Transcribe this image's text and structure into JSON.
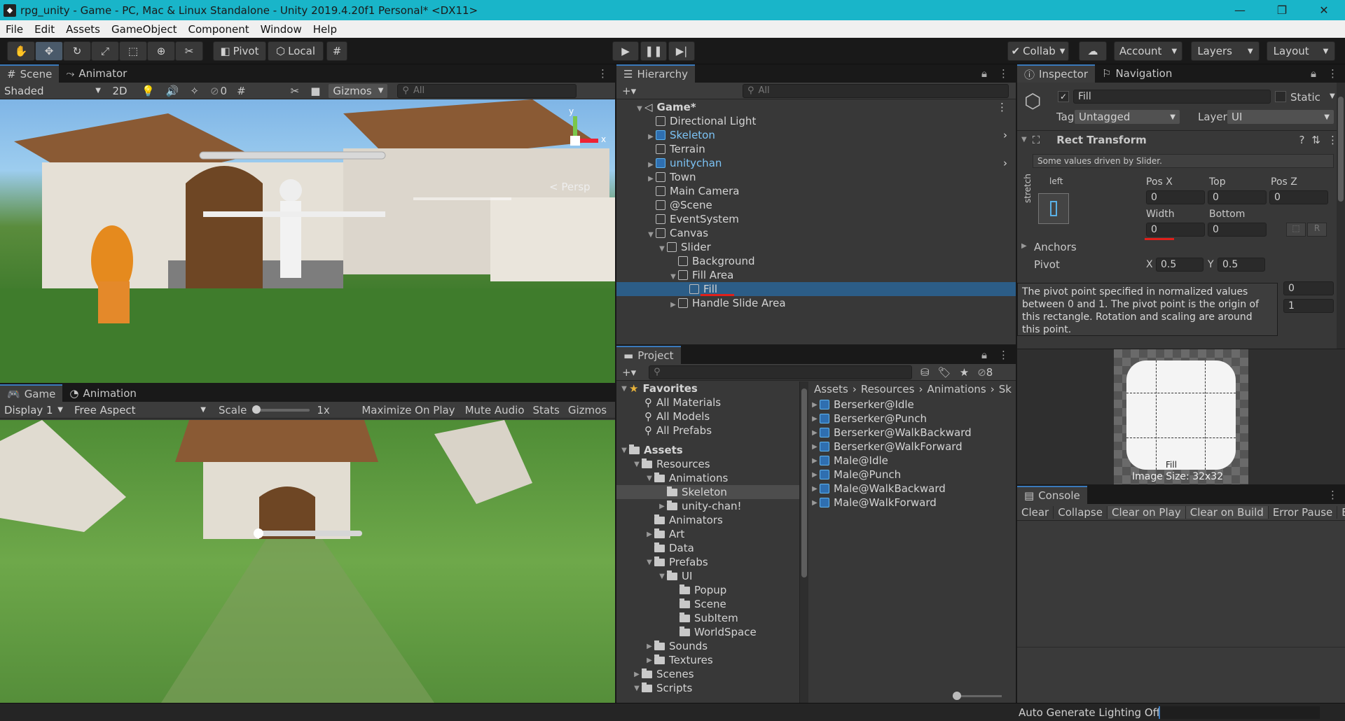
{
  "window": {
    "title": "rpg_unity - Game - PC, Mac & Linux Standalone - Unity 2019.4.20f1 Personal* <DX11>",
    "min": "—",
    "max": "❐",
    "close": "✕"
  },
  "menu": [
    "File",
    "Edit",
    "Assets",
    "GameObject",
    "Component",
    "Window",
    "Help"
  ],
  "toolbar": {
    "pivot": "Pivot",
    "local": "Local",
    "collab": "Collab",
    "account": "Account",
    "layers": "Layers",
    "layout": "Layout"
  },
  "scene": {
    "tabs": {
      "scene": "Scene",
      "animator": "Animator"
    },
    "shading": "Shaded",
    "mode2d": "2D",
    "hidden_count": "0",
    "gizmos": "Gizmos",
    "search_placeholder": "All",
    "gizmo_persp": "< Persp",
    "axis_y": "y",
    "axis_x": "x"
  },
  "game": {
    "tabs": {
      "game": "Game",
      "animation": "Animation"
    },
    "display": "Display 1",
    "aspect": "Free Aspect",
    "scale_label": "Scale",
    "scale_value": "1x",
    "maximize": "Maximize On Play",
    "mute": "Mute Audio",
    "stats": "Stats",
    "gizmos": "Gizmos"
  },
  "hierarchy": {
    "tab": "Hierarchy",
    "search_placeholder": "All",
    "rows": [
      {
        "label": "Game*",
        "indent": 0,
        "expanded": true,
        "scene": true
      },
      {
        "label": "Directional Light",
        "indent": 1
      },
      {
        "label": "Skeleton",
        "indent": 1,
        "prefab": true,
        "collapsed": true
      },
      {
        "label": "Terrain",
        "indent": 1
      },
      {
        "label": "unitychan",
        "indent": 1,
        "prefab": true,
        "collapsed": true
      },
      {
        "label": "Town",
        "indent": 1,
        "collapsed": true
      },
      {
        "label": "Main Camera",
        "indent": 1
      },
      {
        "label": "@Scene",
        "indent": 1
      },
      {
        "label": "EventSystem",
        "indent": 1
      },
      {
        "label": "Canvas",
        "indent": 1,
        "expanded": true
      },
      {
        "label": "Slider",
        "indent": 2,
        "expanded": true
      },
      {
        "label": "Background",
        "indent": 3
      },
      {
        "label": "Fill Area",
        "indent": 3,
        "expanded": true
      },
      {
        "label": "Fill",
        "indent": 4,
        "selected": true
      },
      {
        "label": "Handle Slide Area",
        "indent": 3,
        "collapsed": true
      }
    ]
  },
  "project": {
    "tab": "Project",
    "hidden_count": "8",
    "favorites": {
      "label": "Favorites",
      "items": [
        "All Materials",
        "All Models",
        "All Prefabs"
      ]
    },
    "assets_tree": [
      {
        "label": "Assets",
        "indent": 0,
        "expanded": true,
        "bold": true
      },
      {
        "label": "Resources",
        "indent": 1,
        "expanded": true
      },
      {
        "label": "Animations",
        "indent": 2,
        "expanded": true
      },
      {
        "label": "Skeleton",
        "indent": 3,
        "selected": true
      },
      {
        "label": "unity-chan!",
        "indent": 3,
        "collapsed": true
      },
      {
        "label": "Animators",
        "indent": 2
      },
      {
        "label": "Art",
        "indent": 2,
        "collapsed": true
      },
      {
        "label": "Data",
        "indent": 2
      },
      {
        "label": "Prefabs",
        "indent": 2,
        "expanded": true
      },
      {
        "label": "UI",
        "indent": 3,
        "expanded": true
      },
      {
        "label": "Popup",
        "indent": 4
      },
      {
        "label": "Scene",
        "indent": 4
      },
      {
        "label": "SubItem",
        "indent": 4
      },
      {
        "label": "WorldSpace",
        "indent": 4
      },
      {
        "label": "Sounds",
        "indent": 2,
        "collapsed": true
      },
      {
        "label": "Textures",
        "indent": 2,
        "collapsed": true
      },
      {
        "label": "Scenes",
        "indent": 1,
        "collapsed": true
      },
      {
        "label": "Scripts",
        "indent": 1,
        "expanded": true
      }
    ],
    "breadcrumb": [
      "Assets",
      "Resources",
      "Animations",
      "Sk"
    ],
    "files": [
      "Berserker@Idle",
      "Berserker@Punch",
      "Berserker@WalkBackward",
      "Berserker@WalkForward",
      "Male@Idle",
      "Male@Punch",
      "Male@WalkBackward",
      "Male@WalkForward"
    ]
  },
  "inspector": {
    "tabs": {
      "inspector": "Inspector",
      "navigation": "Navigation"
    },
    "name": "Fill",
    "static": "Static",
    "tag_label": "Tag",
    "tag": "Untagged",
    "layer_label": "Layer",
    "layer": "UI",
    "component": "Rect Transform",
    "driven_note": "Some values driven by Slider.",
    "anchor_preset_top": "left",
    "anchor_preset_side": "stretch",
    "fields": {
      "posx_label": "Pos X",
      "posx": "0",
      "top_label": "Top",
      "top": "0",
      "posz_label": "Pos Z",
      "posz": "0",
      "width_label": "Width",
      "width": "0",
      "bottom_label": "Bottom",
      "bottom": "0"
    },
    "anchors_label": "Anchors",
    "pivot_label": "Pivot",
    "pivot_x_label": "X",
    "pivot_x": "0.5",
    "pivot_y_label": "Y",
    "pivot_y": "0.5",
    "hidden_vals": [
      "0",
      "1"
    ],
    "tooltip": "The pivot point specified in normalized values between 0 and 1. The pivot point is the origin of this rectangle. Rotation and scaling are around this point.",
    "preview_caption": "Fill",
    "preview_size": "Image Size: 32x32"
  },
  "console": {
    "tab": "Console",
    "buttons": [
      "Clear",
      "Collapse",
      "Clear on Play",
      "Clear on Build",
      "Error Pause",
      "Ed"
    ]
  },
  "status": {
    "text": "Auto Generate Lighting Off"
  }
}
